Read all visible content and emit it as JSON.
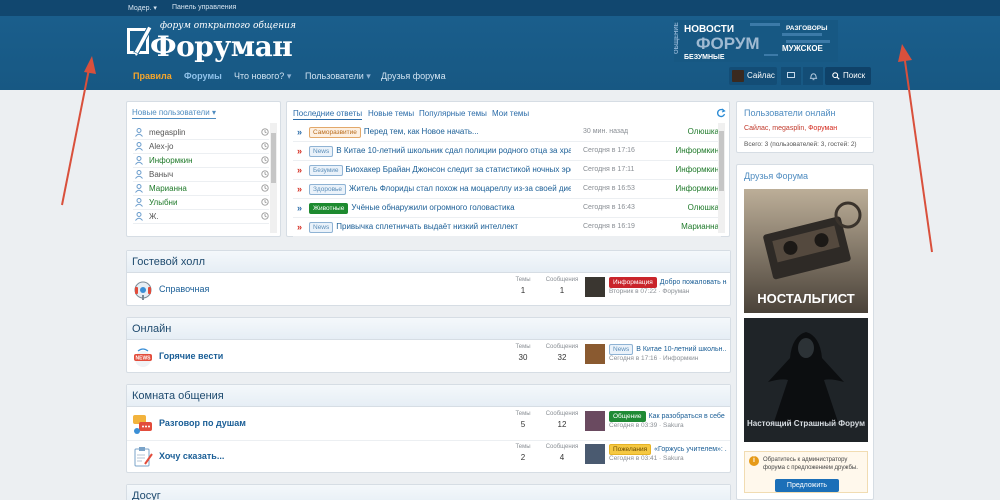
{
  "topbar": {
    "moder": "Модер.",
    "panel": "Панель управления"
  },
  "logo": {
    "tagline": "форум открытого общения",
    "name": "Форуман"
  },
  "banner": {
    "word_main": "ФОРУМ",
    "word_news": "НОВОСТИ",
    "word_talk": "ОБЩЕНИЕ",
    "word_male": "МУЖСКОЕ",
    "word_crazy": "БЕЗУМНЫЕ",
    "word_chats": "РАЗГОВОРЫ"
  },
  "nav": {
    "items": [
      {
        "label": "Правила",
        "state": "active"
      },
      {
        "label": "Форумы",
        "state": "bold"
      },
      {
        "label": "Что нового?",
        "state": "dropdown"
      },
      {
        "label": "Пользователи",
        "state": "dropdown"
      },
      {
        "label": "Друзья форума",
        "state": "normal"
      }
    ],
    "user": "Сайлас",
    "search": "Поиск"
  },
  "new_users": {
    "title": "Новые пользователи",
    "users": [
      {
        "name": "megasplin",
        "color": "muted"
      },
      {
        "name": "Alex-jo",
        "color": "muted"
      },
      {
        "name": "Информкин",
        "color": "green"
      },
      {
        "name": "Ваныч",
        "color": "muted"
      },
      {
        "name": "Марианна",
        "color": "green"
      },
      {
        "name": "Улыбни",
        "color": "green"
      },
      {
        "name": "Ж.",
        "color": "muted"
      }
    ]
  },
  "latest": {
    "tabs": [
      "Последние ответы",
      "Новые темы",
      "Популярные темы",
      "Мои темы"
    ],
    "rows": [
      {
        "badge": "Саморазвитие",
        "badge_class": "b-self",
        "title": "Перед тем, как Новое начать...",
        "time": "30 мин. назад",
        "user": "Олюшка",
        "arrow": "blue"
      },
      {
        "badge": "News",
        "badge_class": "b-news",
        "title": "В Китае 10-летний школьник сдал полиции родного отца за хра...",
        "time": "Сегодня в 17:16",
        "user": "Информкин",
        "arrow": "red"
      },
      {
        "badge": "Безумие",
        "badge_class": "b-insane",
        "title": "Биохакер Брайан Джонсон следит за статистикой ночных эре...",
        "time": "Сегодня в 17:11",
        "user": "Информкин",
        "arrow": "red"
      },
      {
        "badge": "Здоровье",
        "badge_class": "b-health",
        "title": "Житель Флориды стал похож на моцареллу из-за своей диеты",
        "time": "Сегодня в 16:53",
        "user": "Информкин",
        "arrow": "red"
      },
      {
        "badge": "Животные",
        "badge_class": "b-animals",
        "title": "Учёные обнаружили огромного головастика",
        "time": "Сегодня в 16:43",
        "user": "Олюшка",
        "arrow": "blue"
      },
      {
        "badge": "News",
        "badge_class": "b-news",
        "title": "Привычка сплетничать выдаёт низкий интеллект",
        "time": "Сегодня в 16:19",
        "user": "Марианна",
        "arrow": "red"
      }
    ]
  },
  "sections": [
    {
      "title": "Гостевой холл",
      "forums": [
        {
          "name": "Справочная",
          "bold": false,
          "topics_label": "Темы",
          "topics": "1",
          "posts_label": "Сообщения",
          "posts": "1",
          "badge": "Информация",
          "badge_class": "b-info",
          "last_title": "Добро пожаловать на...",
          "last_meta": "Вторник в 07:22 · Форуман",
          "icon": "help-icon"
        }
      ]
    },
    {
      "title": "Онлайн",
      "forums": [
        {
          "name": "Горячие вести",
          "bold": true,
          "topics_label": "Темы",
          "topics": "30",
          "posts_label": "Сообщения",
          "posts": "32",
          "badge": "News",
          "badge_class": "b-news",
          "last_title": "В Китае 10-летний школьн...",
          "last_meta": "Сегодня в 17:16 · Информкин",
          "icon": "news-icon"
        }
      ]
    },
    {
      "title": "Комната общения",
      "forums": [
        {
          "name": "Разговор по душам",
          "bold": true,
          "topics_label": "Темы",
          "topics": "5",
          "posts_label": "Сообщения",
          "posts": "12",
          "badge": "Общение",
          "badge_class": "b-talk",
          "last_title": "Как разобраться в себе ...",
          "last_meta": "Сегодня в 03:39 · Sakura",
          "icon": "chat-icon"
        },
        {
          "name": "Хочу сказать...",
          "bold": true,
          "topics_label": "Темы",
          "topics": "2",
          "posts_label": "Сообщения",
          "posts": "4",
          "badge": "Пожелания",
          "badge_class": "b-wish",
          "last_title": "«Горжусь учителем»: ...",
          "last_meta": "Сегодня в 03:41 · Sakura",
          "icon": "clipboard-icon"
        }
      ]
    },
    {
      "title": "Досуг",
      "forums": []
    }
  ],
  "online": {
    "title": "Пользователи онлайн",
    "users_prefix": "Сайлас, megasplin, ",
    "users_highlight": "Форуман",
    "total": "Всего: 3 (пользователей: 3, гостей: 2)"
  },
  "friends": {
    "title": "Друзья Форума",
    "img1_caption": "НОСТАЛЬГИСТ",
    "img2_caption": "Настоящий Страшный Форум",
    "note": "Обратитесь к администратору форума с предложением дружбы.",
    "button": "Предложить"
  },
  "colors": {
    "header": "#175883",
    "accent_orange": "#f8a62a",
    "link_blue": "#1a5e96",
    "user_green": "#1f7a2a",
    "annotation_red": "#d9503c"
  }
}
